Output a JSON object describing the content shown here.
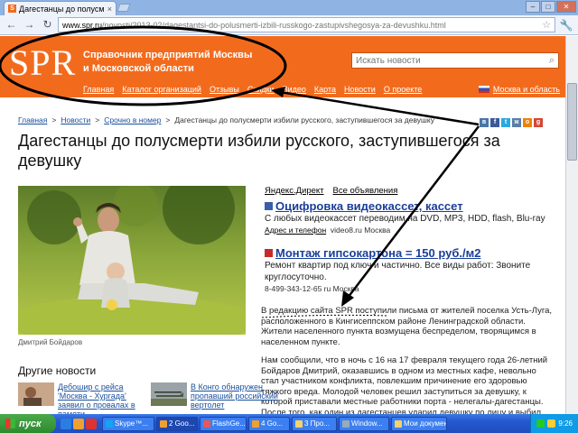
{
  "browser": {
    "tab_title": "Дагестанцы до полусмерт",
    "url_host": "www.spr.ru",
    "url_path": "/novosti/2013-02/dagestantsi-do-polusmerti-izbili-russkogo-zastupivshegosya-za-devushku.html",
    "tab_close": "×",
    "win_min": "–",
    "win_max": "□",
    "win_close": "✕",
    "back": "←",
    "forward": "→",
    "reload": "↻",
    "star": "☆",
    "wrench": "🔧"
  },
  "site": {
    "logo": "SPR",
    "tagline_line1": "Справочник предприятий Москвы",
    "tagline_line2": "и Московской области",
    "search_placeholder": "Искать новости",
    "nav": [
      "Главная",
      "Каталог организаций",
      "Отзывы",
      "Скидки",
      "Видео",
      "Карта",
      "Новости",
      "О проекте"
    ],
    "region": "Москва и область"
  },
  "breadcrumb": {
    "items": [
      "Главная",
      "Новости",
      "Срочно в номер"
    ],
    "separator": ">",
    "current": "Дагестанцы до полусмерти избили русского, заступившегося за девушку"
  },
  "share_icons": [
    "vk",
    "facebook",
    "twitter",
    "livejournal",
    "odnoklassniki",
    "google-plus"
  ],
  "article": {
    "title": "Дагестанцы до полусмерти избили русского, заступившегося за девушку",
    "photo_caption": "Дмитрий Бойдаров",
    "paragraph1": "В редакцию сайта SPR поступили письма от жителей поселка Усть-Луга, расположенного в Кингисеппском районе Ленинградской области. Жители населенного пункта возмущена беспределом, творящимся в населенном пункте.",
    "paragraph2": "Нам сообщили, что в ночь с 16 на 17 февраля текущего года 26-летний Бойдаров Дмитрий, оказавшись в одном из местных кафе, невольно стал участником конфликта, повлекшим причинение его здоровью тяжкого вреда. Молодой человек решил заступиться за девушку, к которой приставали местные работники порта - нелегалы-дагестанцы. После того, как один из дагестанцев ударил девушку по лицу и выбил ей зуб, Бойдаров сделал"
  },
  "direct": {
    "label": "Яндекс.Директ",
    "all_ads": "Все объявления",
    "ads": [
      {
        "title": "Оцифровка видеокассет, кассет",
        "text": "С любых видеокассет переводим на DVD, MP3, HDD, flash, Blu-ray",
        "meta_link": "Адрес и телефон",
        "meta": "video8.ru Москва"
      },
      {
        "title": "Монтаж гипсокартона = 150 руб./м2",
        "text": "Ремонт квартир под ключ и частично. Все виды работ: Звоните круглосуточно.",
        "meta": "8-499-343-12-65 ru Москва"
      }
    ]
  },
  "other_news": {
    "heading": "Другие новости",
    "items": [
      {
        "text": "Дебошир с рейса 'Москва - Хургада' заявил о провалах в памяти"
      },
      {
        "text": "В Конго обнаружен пропавший российский вертолет"
      }
    ]
  },
  "taskbar": {
    "start": "пуск",
    "tasks": [
      "Skype™...",
      "2 Goo...",
      "FlashGe...",
      "4 Go...",
      "3 Про...",
      "Window...",
      "Мои документы"
    ],
    "time": "9:26"
  },
  "colors": {
    "brand_orange": "#f26b1d",
    "link_blue": "#1a4f9c",
    "ad_title_blue": "#1a3e9a"
  }
}
